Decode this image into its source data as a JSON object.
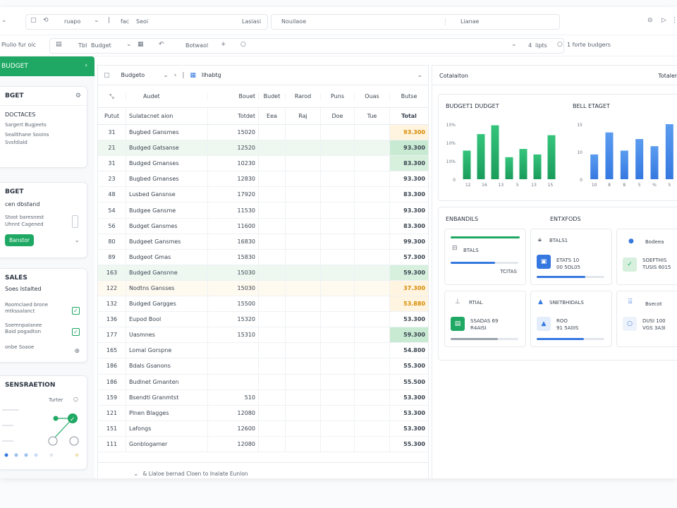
{
  "toolbar": {
    "field1": "ruapo",
    "field2": "fac",
    "field3": "Seoi",
    "field4": "Lasiasi",
    "search_value": "Nouilaoe",
    "field5": "Lianae",
    "row2_label": "Piulio fur oic",
    "tb_label": "TbI",
    "budget_select": "Budget",
    "subtoolbar_label": "Botwaol",
    "count": "4",
    "count_label": "lipts",
    "right_label": "1 forte budgers"
  },
  "left_panel": {
    "title": "BUDGET",
    "card1": {
      "title": "BGET",
      "subtitle": "DOCTACES",
      "line1": "Sargert Bugjeets",
      "line2": "Seallthane Sooins",
      "line3": "Svsfdiald"
    },
    "card2": {
      "title": "BGET",
      "subtitle": "cen dbstand",
      "line1": "Stoot baresnest",
      "line2": "Uhnnt Cagened",
      "button": "Banstor"
    },
    "card3": {
      "title": "SALES",
      "subtitle": "Soes Istalted",
      "line1": "Roomclaed brone",
      "line2": "mtkssalanct",
      "line3": "Soemnpalanee",
      "line4": "Baid pogadton",
      "line5": "onbe Soaoe"
    },
    "card4": {
      "title": "SENSRAETION",
      "label": "Turter"
    }
  },
  "grid": {
    "toolbar_select": "Budgeto",
    "toolbar_label": "Ilhabtg",
    "header1": [
      "Audet",
      "Bouet",
      "Budet",
      "Rarod",
      "Puns",
      "Ouas",
      "Butse"
    ],
    "header2": [
      "Putut",
      "Sulatacnet aion",
      "Totdet",
      "Eea",
      "Raj",
      "Doe",
      "Tue",
      "Total"
    ],
    "rows": [
      {
        "id": "31",
        "name": "Bugbed Gansmes",
        "val": "15020",
        "total": "93.300"
      },
      {
        "id": "21",
        "name": "Budged Gatsanse",
        "val": "12520",
        "total": "93.300"
      },
      {
        "id": "31",
        "name": "Budged Gmanses",
        "val": "10230",
        "total": "83.300"
      },
      {
        "id": "23",
        "name": "Bugbed Gmanses",
        "val": "12830",
        "total": "93.300"
      },
      {
        "id": "48",
        "name": "Lusbed Gansnse",
        "val": "17920",
        "total": "83.300"
      },
      {
        "id": "54",
        "name": "Budgee Gansme",
        "val": "11530",
        "total": "93.300"
      },
      {
        "id": "56",
        "name": "Budget Gansmes",
        "val": "11600",
        "total": "83.300"
      },
      {
        "id": "80",
        "name": "Budgeet Gansmes",
        "val": "16830",
        "total": "99.300"
      },
      {
        "id": "89",
        "name": "Budgeot Gmas",
        "val": "15830",
        "total": "57.300"
      },
      {
        "id": "163",
        "name": "Budged Gansnne",
        "val": "15030",
        "total": "59.300"
      },
      {
        "id": "122",
        "name": "Nodtns Gansses",
        "val": "15030",
        "total": "37.300"
      },
      {
        "id": "132",
        "name": "Budged Gargges",
        "val": "15500",
        "total": "53.880"
      },
      {
        "id": "136",
        "name": "Eupod Bool",
        "val": "15320",
        "total": "53.300"
      },
      {
        "id": "177",
        "name": "Uasmnes",
        "val": "15310",
        "total": "59.300"
      },
      {
        "id": "165",
        "name": "Lomal Gorspne",
        "val": "",
        "total": "54.800"
      },
      {
        "id": "186",
        "name": "Bdals Gsanons",
        "val": "",
        "total": "55.300"
      },
      {
        "id": "186",
        "name": "Budlnet Gmanten",
        "val": "",
        "total": "55.500"
      },
      {
        "id": "159",
        "name": "Bsendtl Granmtst",
        "val": "510",
        "total": "53.300"
      },
      {
        "id": "121",
        "name": "Plnen Blagges",
        "val": "12080",
        "total": "53.300"
      },
      {
        "id": "151",
        "name": "Lafongs",
        "val": "12600",
        "total": "53.300"
      },
      {
        "id": "111",
        "name": "Gonblogamer",
        "val": "12080",
        "total": "55.300"
      }
    ],
    "footer": "& Llaloe  bernad Cloen  to  Inalate Eunlon"
  },
  "right_panel": {
    "header_left": "Cotalaiton",
    "header_right": "Totalen",
    "chart1_title": "BUDGET1 DUDGET",
    "chart2_title": "BELL ETAGET",
    "section_left": "ENBANDILS",
    "section_right": "ENTXFODS",
    "mini": [
      {
        "label": "BTALS",
        "sub": "TCITAS"
      },
      {
        "label": "BTALS1",
        "l1": "ETATS 10",
        "l2": "00 5OL05"
      },
      {
        "label": "Bodeea",
        "l1": "SOEFTHIS",
        "l2": "TUSIS 6015"
      },
      {
        "label": "RTIAL",
        "l1": "SSADAS 69",
        "l2": "R4AISI"
      },
      {
        "label": "SNETBHIDALS",
        "l1": "ROO",
        "l2": "91 5A0IS"
      },
      {
        "label": "Bsecot",
        "l1": "DUSI 100",
        "l2": "VGS 3A3I"
      }
    ]
  },
  "chart_data": [
    {
      "type": "bar",
      "title": "BUDGET1 DUDGET",
      "y_ticks": [
        "15%",
        "10%",
        "10%",
        "0"
      ],
      "x_ticks": [
        "12",
        "16",
        "13",
        "5",
        "13",
        "15"
      ],
      "values": [
        0.52,
        0.82,
        0.98,
        0.4,
        0.55,
        0.45,
        0.8
      ],
      "color_top": "#35c47c",
      "color_bottom": "#1a9c5a"
    },
    {
      "type": "bar",
      "title": "BELL ETAGET",
      "y_ticks": [
        "15",
        "10",
        "0"
      ],
      "x_ticks": [
        "10",
        "8",
        "8",
        "5",
        "%",
        "5"
      ],
      "values": [
        0.45,
        0.85,
        0.52,
        0.73,
        0.6,
        1.0
      ],
      "color_top": "#5b9cf0",
      "color_bottom": "#3578e0"
    }
  ]
}
